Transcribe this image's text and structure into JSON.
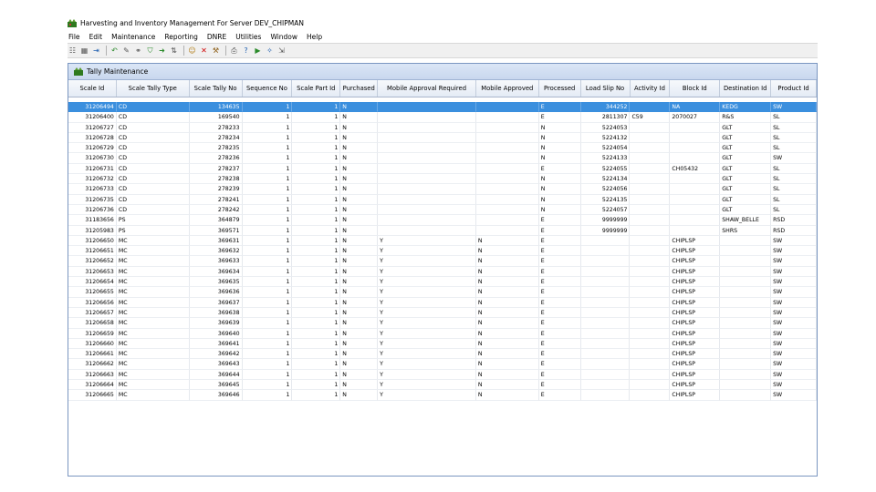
{
  "window": {
    "title": "Harvesting and Inventory Management For Server DEV_CHIPMAN"
  },
  "menu": [
    "File",
    "Edit",
    "Maintenance",
    "Reporting",
    "DNRE",
    "Utilities",
    "Window",
    "Help"
  ],
  "toolbar": {
    "icons": [
      "list-icon",
      "grid-icon",
      "exit-icon",
      "back-icon",
      "edit-icon",
      "link-icon",
      "filter-icon",
      "arrow-icon",
      "sort-icon",
      "people-icon",
      "delete-icon",
      "tools-icon",
      "print-icon",
      "help-icon",
      "play-icon",
      "wand-icon",
      "export-icon"
    ]
  },
  "child": {
    "title": "Tally Maintenance"
  },
  "columns": [
    "Scale Id",
    "Scale Tally Type",
    "Scale Tally No",
    "Sequence No",
    "Scale Part Id",
    "Purchased",
    "Mobile Approval Required",
    "Mobile Approved",
    "Processed",
    "Load Slip No",
    "Activity Id",
    "Block Id",
    "Destination Id",
    "Product Id"
  ],
  "rows": [
    [
      "31206494",
      "CD",
      "134635",
      "1",
      "1",
      "N",
      "",
      "",
      "E",
      "344252",
      "",
      "NA",
      "KEDG",
      "SW"
    ],
    [
      "31206400",
      "CD",
      "169540",
      "1",
      "1",
      "N",
      "",
      "",
      "E",
      "2811307",
      "C59",
      "2070027",
      "R&S",
      "SL"
    ],
    [
      "31206727",
      "CD",
      "278233",
      "1",
      "1",
      "N",
      "",
      "",
      "N",
      "5224053",
      "",
      "",
      "GLT",
      "SL"
    ],
    [
      "31206728",
      "CD",
      "278234",
      "1",
      "1",
      "N",
      "",
      "",
      "N",
      "5224132",
      "",
      "",
      "GLT",
      "SL"
    ],
    [
      "31206729",
      "CD",
      "278235",
      "1",
      "1",
      "N",
      "",
      "",
      "N",
      "5224054",
      "",
      "",
      "GLT",
      "SL"
    ],
    [
      "31206730",
      "CD",
      "278236",
      "1",
      "1",
      "N",
      "",
      "",
      "N",
      "5224133",
      "",
      "",
      "GLT",
      "SW"
    ],
    [
      "31206731",
      "CD",
      "278237",
      "1",
      "1",
      "N",
      "",
      "",
      "E",
      "5224055",
      "",
      "CH05432",
      "GLT",
      "SL"
    ],
    [
      "31206732",
      "CD",
      "278238",
      "1",
      "1",
      "N",
      "",
      "",
      "N",
      "5224134",
      "",
      "",
      "GLT",
      "SL"
    ],
    [
      "31206733",
      "CD",
      "278239",
      "1",
      "1",
      "N",
      "",
      "",
      "N",
      "5224056",
      "",
      "",
      "GLT",
      "SL"
    ],
    [
      "31206735",
      "CD",
      "278241",
      "1",
      "1",
      "N",
      "",
      "",
      "N",
      "5224135",
      "",
      "",
      "GLT",
      "SL"
    ],
    [
      "31206736",
      "CD",
      "278242",
      "1",
      "1",
      "N",
      "",
      "",
      "N",
      "5224057",
      "",
      "",
      "GLT",
      "SL"
    ],
    [
      "31183656",
      "PS",
      "364879",
      "1",
      "1",
      "N",
      "",
      "",
      "E",
      "9999999",
      "",
      "",
      "SHAW_BELLE",
      "RSD"
    ],
    [
      "31205983",
      "PS",
      "369571",
      "1",
      "1",
      "N",
      "",
      "",
      "E",
      "9999999",
      "",
      "",
      "SHRS",
      "RSD"
    ],
    [
      "31206650",
      "MC",
      "369631",
      "1",
      "1",
      "N",
      "Y",
      "N",
      "E",
      "",
      "",
      "CHIPLSP",
      "",
      "SW"
    ],
    [
      "31206651",
      "MC",
      "369632",
      "1",
      "1",
      "N",
      "Y",
      "N",
      "E",
      "",
      "",
      "CHIPLSP",
      "",
      "SW"
    ],
    [
      "31206652",
      "MC",
      "369633",
      "1",
      "1",
      "N",
      "Y",
      "N",
      "E",
      "",
      "",
      "CHIPLSP",
      "",
      "SW"
    ],
    [
      "31206653",
      "MC",
      "369634",
      "1",
      "1",
      "N",
      "Y",
      "N",
      "E",
      "",
      "",
      "CHIPLSP",
      "",
      "SW"
    ],
    [
      "31206654",
      "MC",
      "369635",
      "1",
      "1",
      "N",
      "Y",
      "N",
      "E",
      "",
      "",
      "CHIPLSP",
      "",
      "SW"
    ],
    [
      "31206655",
      "MC",
      "369636",
      "1",
      "1",
      "N",
      "Y",
      "N",
      "E",
      "",
      "",
      "CHIPLSP",
      "",
      "SW"
    ],
    [
      "31206656",
      "MC",
      "369637",
      "1",
      "1",
      "N",
      "Y",
      "N",
      "E",
      "",
      "",
      "CHIPLSP",
      "",
      "SW"
    ],
    [
      "31206657",
      "MC",
      "369638",
      "1",
      "1",
      "N",
      "Y",
      "N",
      "E",
      "",
      "",
      "CHIPLSP",
      "",
      "SW"
    ],
    [
      "31206658",
      "MC",
      "369639",
      "1",
      "1",
      "N",
      "Y",
      "N",
      "E",
      "",
      "",
      "CHIPLSP",
      "",
      "SW"
    ],
    [
      "31206659",
      "MC",
      "369640",
      "1",
      "1",
      "N",
      "Y",
      "N",
      "E",
      "",
      "",
      "CHIPLSP",
      "",
      "SW"
    ],
    [
      "31206660",
      "MC",
      "369641",
      "1",
      "1",
      "N",
      "Y",
      "N",
      "E",
      "",
      "",
      "CHIPLSP",
      "",
      "SW"
    ],
    [
      "31206661",
      "MC",
      "369642",
      "1",
      "1",
      "N",
      "Y",
      "N",
      "E",
      "",
      "",
      "CHIPLSP",
      "",
      "SW"
    ],
    [
      "31206662",
      "MC",
      "369643",
      "1",
      "1",
      "N",
      "Y",
      "N",
      "E",
      "",
      "",
      "CHIPLSP",
      "",
      "SW"
    ],
    [
      "31206663",
      "MC",
      "369644",
      "1",
      "1",
      "N",
      "Y",
      "N",
      "E",
      "",
      "",
      "CHIPLSP",
      "",
      "SW"
    ],
    [
      "31206664",
      "MC",
      "369645",
      "1",
      "1",
      "N",
      "Y",
      "N",
      "E",
      "",
      "",
      "CHIPLSP",
      "",
      "SW"
    ],
    [
      "31206665",
      "MC",
      "369646",
      "1",
      "1",
      "N",
      "Y",
      "N",
      "E",
      "",
      "",
      "CHIPLSP",
      "",
      "SW"
    ]
  ],
  "selected_row": 0,
  "colors": {
    "selection": "#3b8fde",
    "header_gradient_top": "#f7f9fc",
    "header_gradient_bottom": "#e4ebf5"
  }
}
